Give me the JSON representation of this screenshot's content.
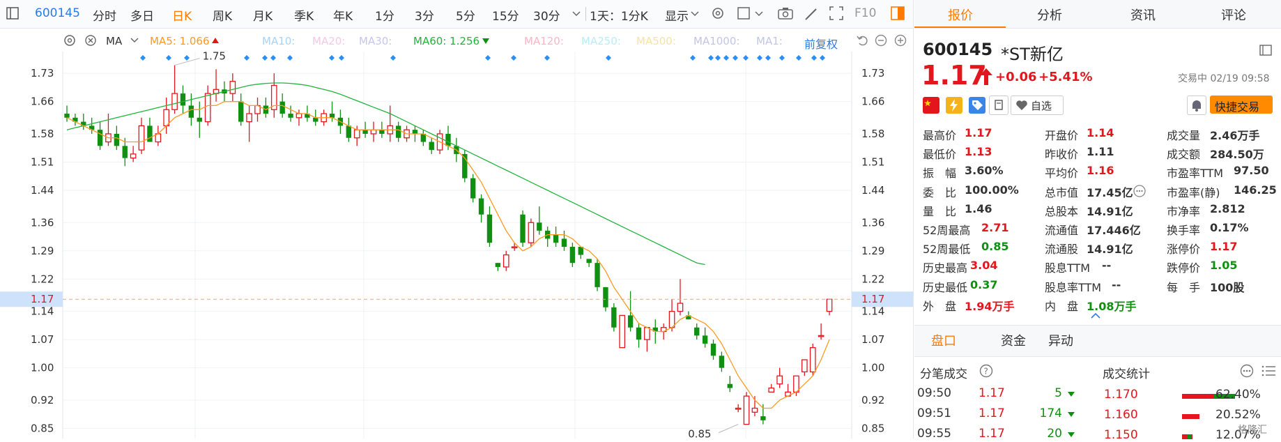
{
  "toolbar": {
    "code": "600145",
    "periods": [
      "分时",
      "多日",
      "日K",
      "周K",
      "月K",
      "季K",
      "年K",
      "1分",
      "3分",
      "5分",
      "15分",
      "30分"
    ],
    "active_period": "日K",
    "range": "1天：1分K",
    "display": "显示",
    "f10": "F10"
  },
  "ma_bar": {
    "title": "MA",
    "ma5": "MA5: 1.066",
    "ma10": "MA10:",
    "ma20": "MA20:",
    "ma30": "MA30:",
    "ma60": "MA60: 1.256",
    "ma120": "MA120:",
    "ma250": "MA250:",
    "ma500": "MA500:",
    "ma1000": "MA1000:",
    "ma1": "MA1:",
    "adjust": "前复权",
    "colors": {
      "ma5": "#ff9a1f",
      "ma60": "#22b33c",
      "up": "#e4161d",
      "down": "#109010"
    }
  },
  "chart_data": {
    "type": "candlestick",
    "y_ticks": [
      "1.73",
      "1.66",
      "1.58",
      "1.51",
      "1.44",
      "1.36",
      "1.29",
      "1.22",
      "1.14",
      "1.07",
      "1.00",
      "0.92",
      "0.85"
    ],
    "y_range": [
      0.83,
      1.77
    ],
    "current_price": "1.17",
    "high_label": "1.75",
    "low_label": "0.85",
    "candles": [
      [
        1.63,
        1.65,
        1.61,
        1.62
      ],
      [
        1.62,
        1.63,
        1.6,
        1.61
      ],
      [
        1.61,
        1.63,
        1.59,
        1.6
      ],
      [
        1.6,
        1.62,
        1.58,
        1.59
      ],
      [
        1.59,
        1.61,
        1.54,
        1.55
      ],
      [
        1.56,
        1.63,
        1.55,
        1.58
      ],
      [
        1.58,
        1.6,
        1.54,
        1.55
      ],
      [
        1.55,
        1.57,
        1.5,
        1.52
      ],
      [
        1.52,
        1.55,
        1.51,
        1.53
      ],
      [
        1.54,
        1.62,
        1.53,
        1.6
      ],
      [
        1.6,
        1.62,
        1.56,
        1.56
      ],
      [
        1.56,
        1.6,
        1.55,
        1.58
      ],
      [
        1.6,
        1.67,
        1.58,
        1.64
      ],
      [
        1.64,
        1.75,
        1.63,
        1.68
      ],
      [
        1.68,
        1.7,
        1.63,
        1.65
      ],
      [
        1.65,
        1.68,
        1.6,
        1.62
      ],
      [
        1.62,
        1.66,
        1.57,
        1.61
      ],
      [
        1.61,
        1.7,
        1.6,
        1.68
      ],
      [
        1.68,
        1.74,
        1.66,
        1.69
      ],
      [
        1.69,
        1.71,
        1.66,
        1.68
      ],
      [
        1.68,
        1.73,
        1.66,
        1.71
      ],
      [
        1.66,
        1.68,
        1.6,
        1.61
      ],
      [
        1.61,
        1.65,
        1.56,
        1.63
      ],
      [
        1.63,
        1.67,
        1.61,
        1.65
      ],
      [
        1.65,
        1.67,
        1.62,
        1.63
      ],
      [
        1.64,
        1.73,
        1.62,
        1.7
      ],
      [
        1.66,
        1.68,
        1.62,
        1.63
      ],
      [
        1.63,
        1.65,
        1.61,
        1.62
      ],
      [
        1.62,
        1.64,
        1.6,
        1.63
      ],
      [
        1.63,
        1.65,
        1.61,
        1.62
      ],
      [
        1.62,
        1.64,
        1.6,
        1.61
      ],
      [
        1.61,
        1.64,
        1.6,
        1.63
      ],
      [
        1.63,
        1.66,
        1.61,
        1.62
      ],
      [
        1.62,
        1.64,
        1.58,
        1.6
      ],
      [
        1.6,
        1.62,
        1.56,
        1.57
      ],
      [
        1.57,
        1.6,
        1.55,
        1.59
      ],
      [
        1.59,
        1.61,
        1.57,
        1.58
      ],
      [
        1.58,
        1.61,
        1.56,
        1.59
      ],
      [
        1.59,
        1.61,
        1.57,
        1.58
      ],
      [
        1.58,
        1.65,
        1.56,
        1.6
      ],
      [
        1.6,
        1.61,
        1.56,
        1.57
      ],
      [
        1.57,
        1.6,
        1.56,
        1.59
      ],
      [
        1.59,
        1.6,
        1.56,
        1.58
      ],
      [
        1.58,
        1.59,
        1.55,
        1.56
      ],
      [
        1.56,
        1.57,
        1.53,
        1.54
      ],
      [
        1.54,
        1.59,
        1.53,
        1.58
      ],
      [
        1.58,
        1.6,
        1.54,
        1.55
      ],
      [
        1.55,
        1.57,
        1.51,
        1.53
      ],
      [
        1.53,
        1.54,
        1.46,
        1.47
      ],
      [
        1.47,
        1.48,
        1.41,
        1.42
      ],
      [
        1.42,
        1.43,
        1.36,
        1.38
      ],
      [
        1.38,
        1.4,
        1.3,
        1.31
      ],
      [
        1.26,
        1.26,
        1.24,
        1.25
      ],
      [
        1.25,
        1.29,
        1.24,
        1.28
      ],
      [
        1.3,
        1.31,
        1.29,
        1.3
      ],
      [
        1.38,
        1.39,
        1.3,
        1.31
      ],
      [
        1.31,
        1.37,
        1.3,
        1.36
      ],
      [
        1.36,
        1.4,
        1.33,
        1.34
      ],
      [
        1.34,
        1.35,
        1.3,
        1.32
      ],
      [
        1.33,
        1.35,
        1.3,
        1.31
      ],
      [
        1.32,
        1.34,
        1.29,
        1.3
      ],
      [
        1.3,
        1.31,
        1.25,
        1.26
      ],
      [
        1.3,
        1.3,
        1.27,
        1.28
      ],
      [
        1.27,
        1.27,
        1.25,
        1.26
      ],
      [
        1.26,
        1.27,
        1.19,
        1.2
      ],
      [
        1.2,
        1.2,
        1.14,
        1.15
      ],
      [
        1.15,
        1.16,
        1.09,
        1.1
      ],
      [
        1.05,
        1.13,
        1.05,
        1.13
      ],
      [
        1.13,
        1.19,
        1.09,
        1.1
      ],
      [
        1.1,
        1.11,
        1.05,
        1.07
      ],
      [
        1.07,
        1.1,
        1.04,
        1.1
      ],
      [
        1.1,
        1.12,
        1.06,
        1.09
      ],
      [
        1.09,
        1.11,
        1.07,
        1.1
      ],
      [
        1.1,
        1.17,
        1.09,
        1.14
      ],
      [
        1.14,
        1.22,
        1.13,
        1.16
      ],
      [
        1.13,
        1.14,
        1.12,
        1.12
      ],
      [
        1.1,
        1.11,
        1.07,
        1.08
      ],
      [
        1.08,
        1.1,
        1.05,
        1.06
      ],
      [
        1.06,
        1.07,
        1.02,
        1.03
      ],
      [
        1.03,
        1.04,
        0.99,
        1.0
      ],
      [
        0.96,
        0.98,
        0.94,
        0.95
      ],
      [
        0.9,
        0.91,
        0.89,
        0.9
      ],
      [
        0.86,
        0.94,
        0.86,
        0.93
      ],
      [
        0.89,
        0.93,
        0.88,
        0.9
      ],
      [
        0.88,
        0.91,
        0.86,
        0.87
      ],
      [
        0.94,
        0.96,
        0.94,
        0.95
      ],
      [
        0.96,
        1.0,
        0.95,
        0.98
      ],
      [
        0.93,
        0.96,
        0.93,
        0.94
      ],
      [
        0.94,
        0.98,
        0.93,
        0.98
      ],
      [
        0.99,
        1.02,
        0.98,
        1.02
      ],
      [
        0.99,
        1.06,
        0.98,
        1.05
      ],
      [
        1.08,
        1.11,
        1.07,
        1.08
      ],
      [
        1.14,
        1.17,
        1.13,
        1.17
      ]
    ],
    "ma5": [
      1.62,
      1.61,
      1.6,
      1.59,
      1.58,
      1.57,
      1.57,
      1.56,
      1.56,
      1.56,
      1.57,
      1.58,
      1.6,
      1.62,
      1.63,
      1.64,
      1.64,
      1.65,
      1.65,
      1.66,
      1.66,
      1.66,
      1.65,
      1.65,
      1.64,
      1.65,
      1.65,
      1.64,
      1.63,
      1.63,
      1.62,
      1.62,
      1.62,
      1.61,
      1.6,
      1.59,
      1.59,
      1.59,
      1.59,
      1.59,
      1.59,
      1.58,
      1.58,
      1.58,
      1.57,
      1.56,
      1.55,
      1.54,
      1.52,
      1.49,
      1.46,
      1.42,
      1.38,
      1.34,
      1.31,
      1.29,
      1.3,
      1.32,
      1.33,
      1.33,
      1.33,
      1.32,
      1.3,
      1.29,
      1.27,
      1.24,
      1.2,
      1.17,
      1.14,
      1.11,
      1.1,
      1.09,
      1.09,
      1.1,
      1.12,
      1.13,
      1.12,
      1.11,
      1.09,
      1.06,
      1.02,
      0.98,
      0.95,
      0.92,
      0.9,
      0.9,
      0.92,
      0.93,
      0.94,
      0.96,
      0.98,
      1.02,
      1.07
    ],
    "ma60": [
      1.59,
      1.595,
      1.6,
      1.605,
      1.61,
      1.615,
      1.62,
      1.625,
      1.63,
      1.635,
      1.64,
      1.645,
      1.65,
      1.655,
      1.66,
      1.665,
      1.67,
      1.675,
      1.68,
      1.685,
      1.69,
      1.695,
      1.7,
      1.703,
      1.705,
      1.706,
      1.706,
      1.705,
      1.703,
      1.7,
      1.695,
      1.69,
      1.685,
      1.678,
      1.67,
      1.662,
      1.654,
      1.646,
      1.638,
      1.63,
      1.62,
      1.61,
      1.6,
      1.59,
      1.58,
      1.57,
      1.56,
      1.55,
      1.54,
      1.53,
      1.52,
      1.51,
      1.5,
      1.49,
      1.48,
      1.47,
      1.46,
      1.45,
      1.44,
      1.43,
      1.42,
      1.41,
      1.4,
      1.39,
      1.38,
      1.37,
      1.36,
      1.35,
      1.34,
      1.33,
      1.32,
      1.31,
      1.3,
      1.29,
      1.28,
      1.27,
      1.26,
      1.256
    ]
  },
  "quote": {
    "tabs": [
      "报价",
      "分析",
      "资讯",
      "评论"
    ],
    "code": "600145",
    "name": "*ST新亿",
    "price": "1.17",
    "change": "+0.06",
    "pct": "+5.41%",
    "status": "交易中 02/19 09:58",
    "watch": "自选",
    "trade": "快捷交易",
    "stats": [
      [
        [
          "最高价",
          "1.17",
          "red"
        ],
        [
          "开盘价",
          "1.14",
          "red"
        ],
        [
          "成交量",
          "2.46万手",
          "dark"
        ]
      ],
      [
        [
          "最低价",
          "1.13",
          "red"
        ],
        [
          "昨收价",
          "1.11",
          "dark"
        ],
        [
          "成交额",
          "284.50万",
          "dark"
        ]
      ],
      [
        [
          "振　幅",
          "3.60%",
          "dark"
        ],
        [
          "平均价",
          "1.16",
          "red"
        ],
        [
          "市盈率TTM",
          "97.50",
          "dark"
        ]
      ],
      [
        [
          "委　比",
          "100.00%",
          "dark"
        ],
        [
          "总市值",
          "17.45亿",
          "dark"
        ],
        [
          "市盈率(静)",
          "146.25",
          "dark"
        ]
      ],
      [
        [
          "量　比",
          "1.46",
          "dark"
        ],
        [
          "总股本",
          "14.91亿",
          "dark"
        ],
        [
          "市净率",
          "2.812",
          "dark"
        ]
      ],
      [
        [
          "52周最高",
          "2.71",
          "red"
        ],
        [
          "流通值",
          "17.446亿",
          "dark"
        ],
        [
          "换手率",
          "0.17%",
          "dark"
        ]
      ],
      [
        [
          "52周最低",
          "0.85",
          "green"
        ],
        [
          "流通股",
          "14.91亿",
          "dark"
        ],
        [
          "涨停价",
          "1.17",
          "red"
        ]
      ],
      [
        [
          "历史最高",
          "3.04",
          "red"
        ],
        [
          "股息TTM",
          "--",
          "dark"
        ],
        [
          "跌停价",
          "1.05",
          "green"
        ]
      ],
      [
        [
          "历史最低",
          "0.37",
          "green"
        ],
        [
          "股息率TTM",
          "--",
          "dark"
        ],
        [
          "每　手",
          "100股",
          "dark"
        ]
      ],
      [
        [
          "外　盘",
          "1.94万手",
          "red"
        ],
        [
          "内　盘",
          "1.08万手",
          "green"
        ],
        [
          "",
          "",
          " "
        ]
      ]
    ],
    "subtabs": [
      "盘口",
      "资金",
      "异动"
    ],
    "ticks_title": "分笔成交",
    "stats_title": "成交统计",
    "ticks": [
      [
        "09:50",
        "1.17",
        "5"
      ],
      [
        "09:51",
        "1.17",
        "174"
      ],
      [
        "09:55",
        "1.17",
        "20"
      ]
    ],
    "dist": [
      [
        "1.170",
        "62.40%"
      ],
      [
        "1.160",
        "20.52%"
      ],
      [
        "1.150",
        "12.07%"
      ]
    ],
    "watermark": "格隆汇"
  }
}
